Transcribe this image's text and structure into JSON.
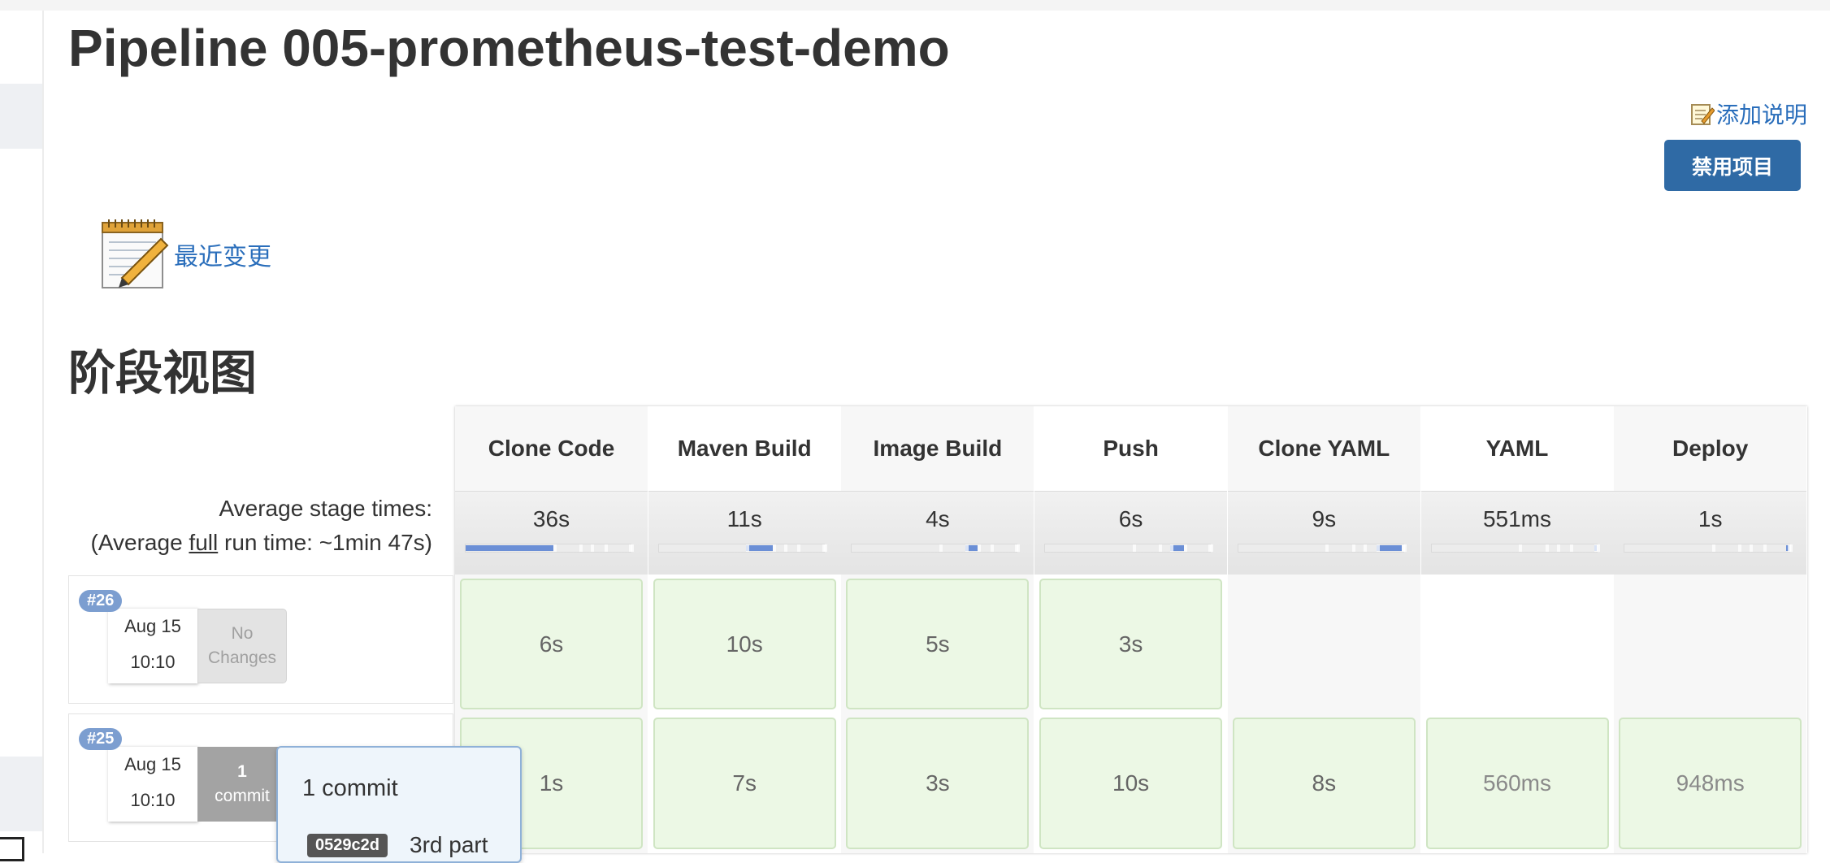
{
  "page": {
    "title": "Pipeline 005-prometheus-test-demo",
    "add_description": "添加说明",
    "disable_button": "禁用项目",
    "recent_changes": "最近变更",
    "stage_view_title": "阶段视图"
  },
  "avg": {
    "line1": "Average stage times:",
    "line2_prefix": "(Average ",
    "line2_link": "full",
    "line2_suffix": " run time: ~1min 47s)"
  },
  "stages": [
    {
      "name": "Clone Code",
      "avg": "36s",
      "avg_bar_fraction": 0.53
    },
    {
      "name": "Maven Build",
      "avg": "11s",
      "avg_bar_fraction": 0.16
    },
    {
      "name": "Image Build",
      "avg": "4s",
      "avg_bar_fraction": 0.07
    },
    {
      "name": "Push",
      "avg": "6s",
      "avg_bar_fraction": 0.08
    },
    {
      "name": "Clone YAML",
      "avg": "9s",
      "avg_bar_fraction": 0.15
    },
    {
      "name": "YAML",
      "avg": "551ms",
      "avg_bar_fraction": 0.01
    },
    {
      "name": "Deploy",
      "avg": "1s",
      "avg_bar_fraction": 0.02
    }
  ],
  "builds": [
    {
      "number": "#26",
      "date": "Aug 15",
      "time": "10:10",
      "changes": {
        "line1": "No",
        "line2": "Changes"
      },
      "durations": [
        "6s",
        "10s",
        "5s",
        "3s",
        "",
        "",
        ""
      ]
    },
    {
      "number": "#25",
      "date": "Aug 15",
      "time": "10:10",
      "changes": {
        "line1": "1",
        "line2": "commit"
      },
      "durations": [
        "1s",
        "7s",
        "3s",
        "10s",
        "8s",
        "560ms",
        "948ms"
      ]
    }
  ],
  "popover": {
    "title": "1 commit",
    "commit_sha": "0529c2d",
    "commit_msg": "3rd part"
  },
  "colors": {
    "accent_link": "#2a6ebb",
    "button_bg": "#2f6aa5",
    "success_cell": "#ecf8e5",
    "avg_bar_fill": "#6b8fd6"
  }
}
